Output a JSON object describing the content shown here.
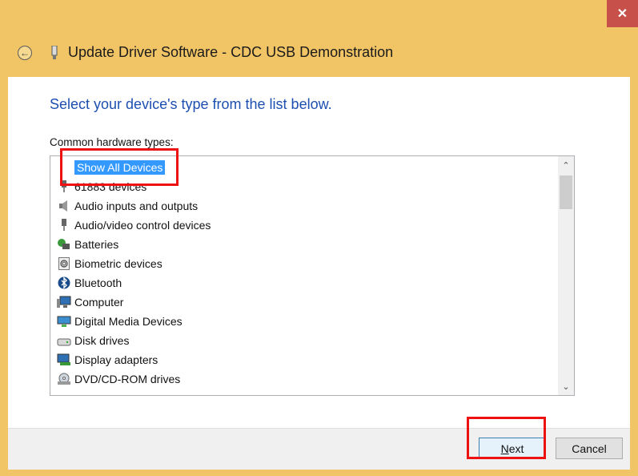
{
  "window": {
    "title": "Update Driver Software - CDC USB Demonstration",
    "close_label": "✕"
  },
  "main": {
    "heading": "Select your device's type from the list below.",
    "list_label": "Common hardware types:",
    "items": [
      {
        "label": "Show All Devices",
        "icon": "none",
        "selected": true
      },
      {
        "label": "61883 devices",
        "icon": "plug-icon"
      },
      {
        "label": "Audio inputs and outputs",
        "icon": "speaker-icon"
      },
      {
        "label": "Audio/video control devices",
        "icon": "plug-icon"
      },
      {
        "label": "Batteries",
        "icon": "battery-icon"
      },
      {
        "label": "Biometric devices",
        "icon": "fingerprint-icon"
      },
      {
        "label": "Bluetooth",
        "icon": "bluetooth-icon"
      },
      {
        "label": "Computer",
        "icon": "computer-icon"
      },
      {
        "label": "Digital Media Devices",
        "icon": "media-device-icon"
      },
      {
        "label": "Disk drives",
        "icon": "disk-drive-icon"
      },
      {
        "label": "Display adapters",
        "icon": "display-adapter-icon"
      },
      {
        "label": "DVD/CD-ROM drives",
        "icon": "dvd-drive-icon"
      }
    ]
  },
  "footer": {
    "next_label": "Next",
    "cancel_label": "Cancel"
  },
  "colors": {
    "window_frame": "#f1c565",
    "heading": "#1d4fb0",
    "selection": "#3399ff",
    "annotation": "#ee1111"
  }
}
